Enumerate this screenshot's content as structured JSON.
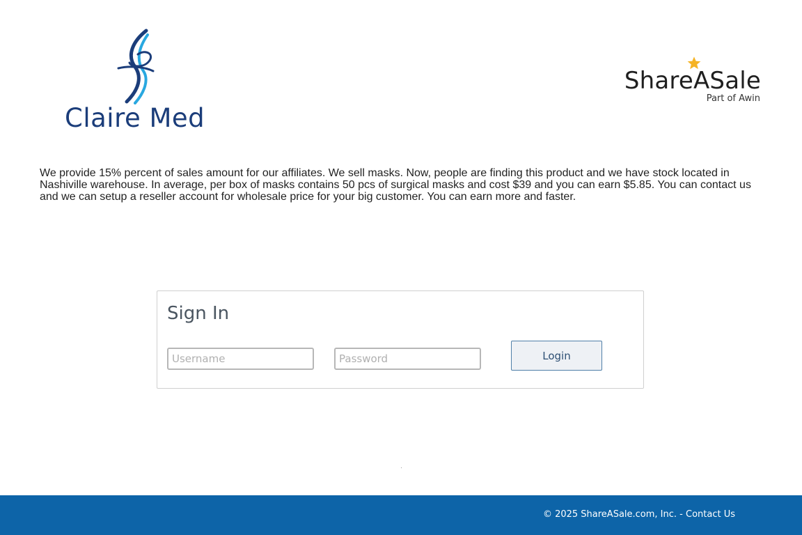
{
  "header": {
    "merchant_logo_text": "Claire Med",
    "network_logo_text": "ShareASale",
    "network_tagline": "Part of Awin"
  },
  "description": "We provide 15% percent of sales amount for our affiliates. We sell masks. Now, people are finding this product and we have stock located in Nashiville warehouse. In average, per box of masks contains 50 pcs of surgical masks and cost $39 and you can earn $5.85. You can contact us and we can setup a reseller account for wholesale price for your big customer. You can earn more and faster.",
  "signin": {
    "title": "Sign In",
    "username_placeholder": "Username",
    "username_value": "",
    "password_placeholder": "Password",
    "password_value": "",
    "login_label": "Login"
  },
  "footer": {
    "copyright": "© 2025 ShareASale.com, Inc. - ",
    "contact_label": "Contact Us"
  },
  "colors": {
    "footer_bg": "#0d64a8",
    "merchant_logo_blue": "#1b3d7a",
    "merchant_logo_cyan": "#29a8e0",
    "network_star": "#f5b324",
    "login_border": "#4f7fa8"
  },
  "icons": {
    "merchant_logo": "claire-med-swirl-logo",
    "network_star": "star-icon"
  }
}
